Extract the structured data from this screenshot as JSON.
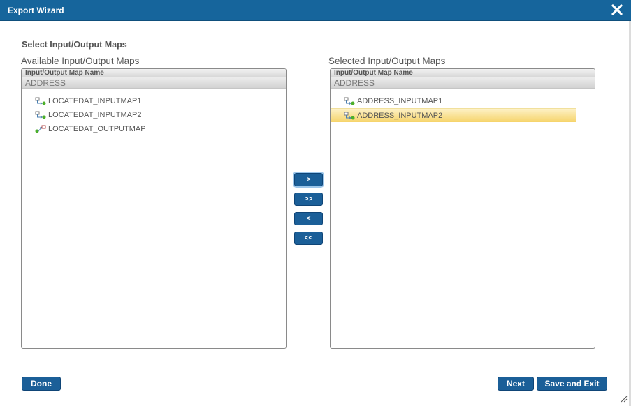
{
  "window": {
    "title": "Export Wizard"
  },
  "section_heading": "Select Input/Output Maps",
  "available": {
    "label": "Available Input/Output Maps",
    "column_header": "Input/Output Map Name",
    "group": "ADDRESS",
    "items": [
      {
        "name": "LOCATEDAT_INPUTMAP1",
        "icon": "input-map-icon"
      },
      {
        "name": "LOCATEDAT_INPUTMAP2",
        "icon": "input-map-icon"
      },
      {
        "name": "LOCATEDAT_OUTPUTMAP",
        "icon": "output-map-icon"
      }
    ]
  },
  "selected": {
    "label": "Selected Input/Output Maps",
    "column_header": "Input/Output Map Name",
    "group": "ADDRESS",
    "items": [
      {
        "name": "ADDRESS_INPUTMAP1",
        "icon": "input-map-icon",
        "highlighted": false
      },
      {
        "name": "ADDRESS_INPUTMAP2",
        "icon": "input-map-icon",
        "highlighted": true
      }
    ]
  },
  "transfer_buttons": {
    "move_right": ">",
    "move_all_right": ">>",
    "move_left": "<",
    "move_all_left": "<<"
  },
  "footer": {
    "done": "Done",
    "next": "Next",
    "save_and_exit": "Save and Exit"
  },
  "colors": {
    "titlebar": "#16659c",
    "button": "#1b5f98",
    "selection": "#f6d46b"
  }
}
